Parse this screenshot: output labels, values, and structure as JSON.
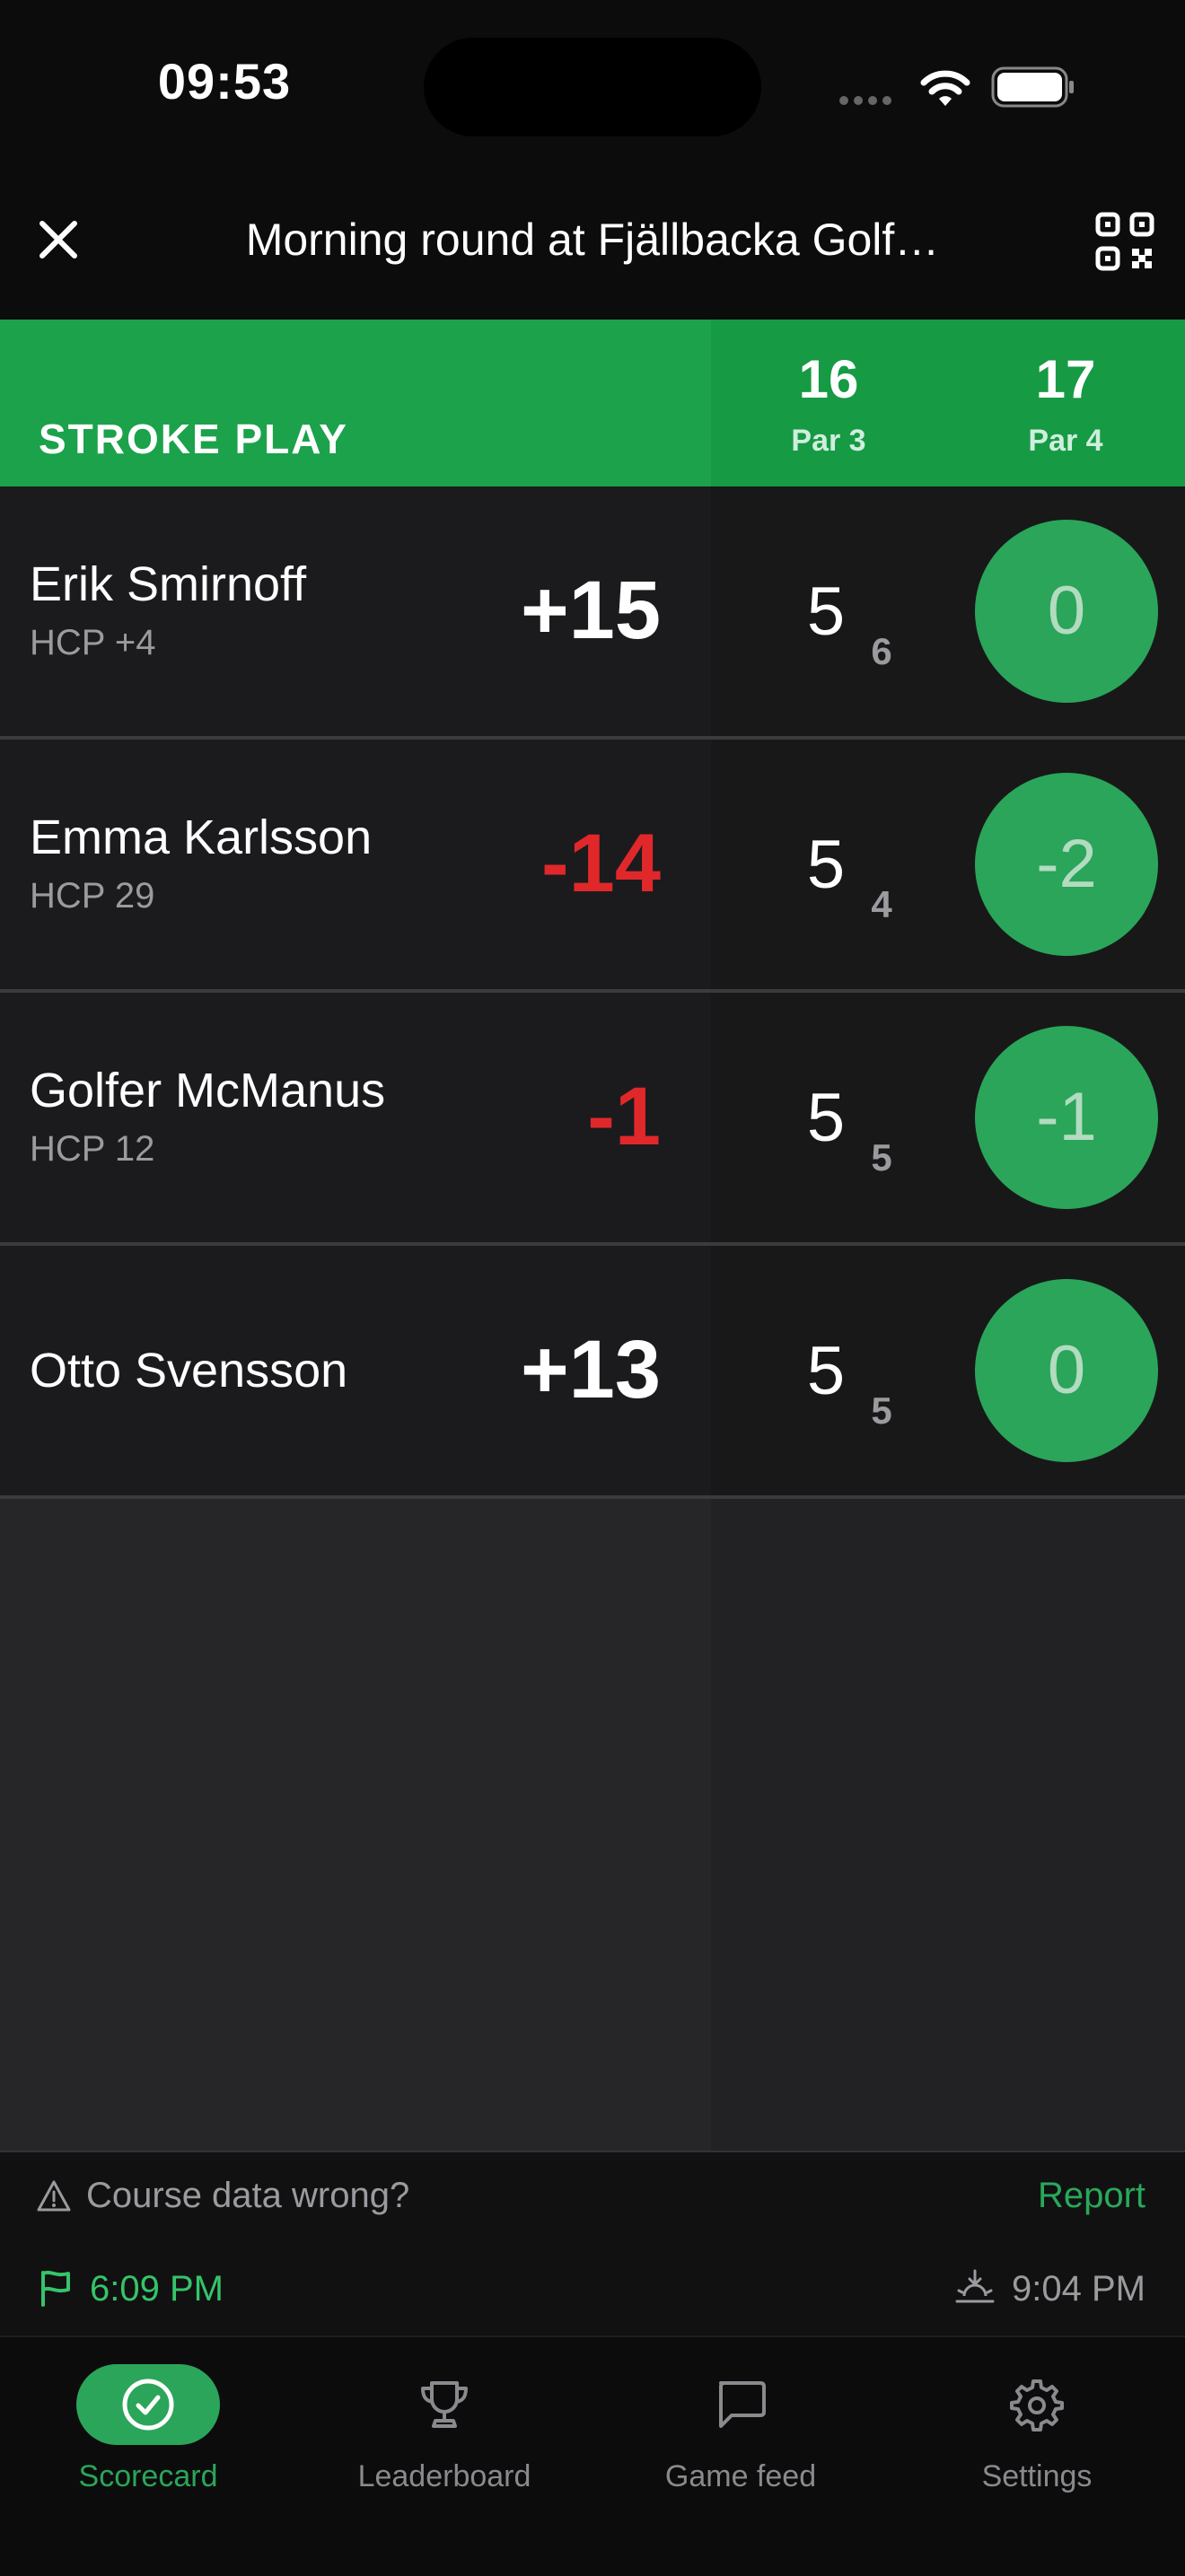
{
  "status_bar": {
    "time": "09:53"
  },
  "header": {
    "title": "Morning round at Fjällbacka Golf…"
  },
  "game": {
    "type": "STROKE PLAY",
    "holes": [
      {
        "number": "16",
        "par": "Par 3"
      },
      {
        "number": "17",
        "par": "Par 4"
      }
    ]
  },
  "players": [
    {
      "name": "Erik Smirnoff",
      "hcp": "HCP +4",
      "total": "+15",
      "gross": "5",
      "net": "6",
      "hole17": "0"
    },
    {
      "name": "Emma Karlsson",
      "hcp": "HCP 29",
      "total": "-14",
      "gross": "5",
      "net": "4",
      "hole17": "-2"
    },
    {
      "name": "Golfer McManus",
      "hcp": "HCP 12",
      "total": "-1",
      "gross": "5",
      "net": "5",
      "hole17": "-1"
    },
    {
      "name": "Otto Svensson",
      "hcp": "",
      "total": "+13",
      "gross": "5",
      "net": "5",
      "hole17": "0"
    }
  ],
  "footer": {
    "report_question": "Course data wrong?",
    "report_link": "Report",
    "tee_time": "6:09 PM",
    "sunset_time": "9:04 PM"
  },
  "tabs": [
    {
      "label": "Scorecard",
      "icon": "check-circle-icon",
      "active": true
    },
    {
      "label": "Leaderboard",
      "icon": "trophy-icon",
      "active": false
    },
    {
      "label": "Game feed",
      "icon": "chat-bubble-icon",
      "active": false
    },
    {
      "label": "Settings",
      "icon": "gear-icon",
      "active": false
    }
  ],
  "colors": {
    "accent": "#1ba24b",
    "negative": "#e0282b",
    "background": "#1b1b1d"
  }
}
